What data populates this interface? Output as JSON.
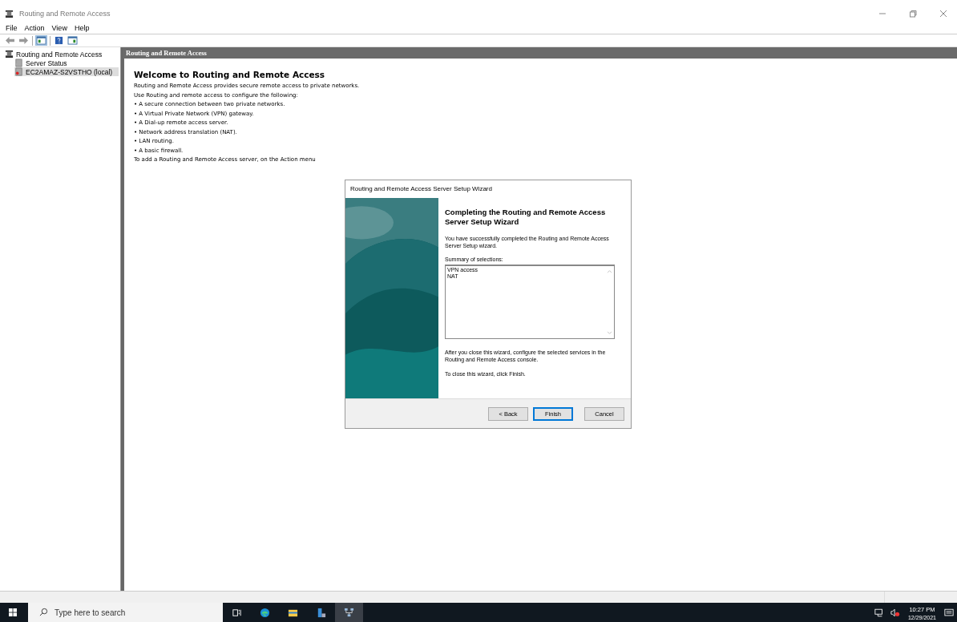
{
  "window": {
    "title": "Routing and Remote Access"
  },
  "menu": [
    "File",
    "Action",
    "View",
    "Help"
  ],
  "tree": [
    {
      "label": "Routing and Remote Access",
      "selected": false,
      "children": [
        {
          "label": "Server Status",
          "selected": false
        },
        {
          "label": "EC2AMAZ-S2VSTHO (local)",
          "selected": true
        }
      ]
    }
  ],
  "content": {
    "header": "Routing and Remote Access",
    "heading": "Welcome to Routing and Remote Access",
    "lines": [
      "Routing and Remote Access provides secure remote access to private networks.",
      "Use Routing and remote access to configure the following:",
      "• A secure connection between two private networks.",
      "• A Virtual Private Network (VPN) gateway.",
      "• A Dial-up remote access server.",
      "• Network address translation (NAT).",
      "• LAN routing.",
      "• A basic firewall.",
      "To add a Routing and Remote Access server, on the Action menu"
    ]
  },
  "dialog": {
    "title": "Routing and Remote Access Server Setup Wizard",
    "heading": "Completing the Routing and Remote Access Server Setup Wizard",
    "intro": "You have successfully completed the Routing and Remote Access Server Setup wizard.",
    "summary_label": "Summary of selections:",
    "summary": [
      "VPN access",
      "NAT"
    ],
    "after": "After you close this wizard, configure the selected services in the Routing and  Remote Access console.",
    "close_hint": "To close this wizard, click Finish.",
    "buttons": [
      {
        "label": "< Back",
        "selected": false
      },
      {
        "label": "Finish",
        "selected": true
      },
      {
        "label": "Cancel",
        "selected": false
      }
    ]
  },
  "taskbar": {
    "search": {
      "placeholder": "Type here to search"
    },
    "time": "10:27 PM",
    "date": "12/29/2021"
  }
}
